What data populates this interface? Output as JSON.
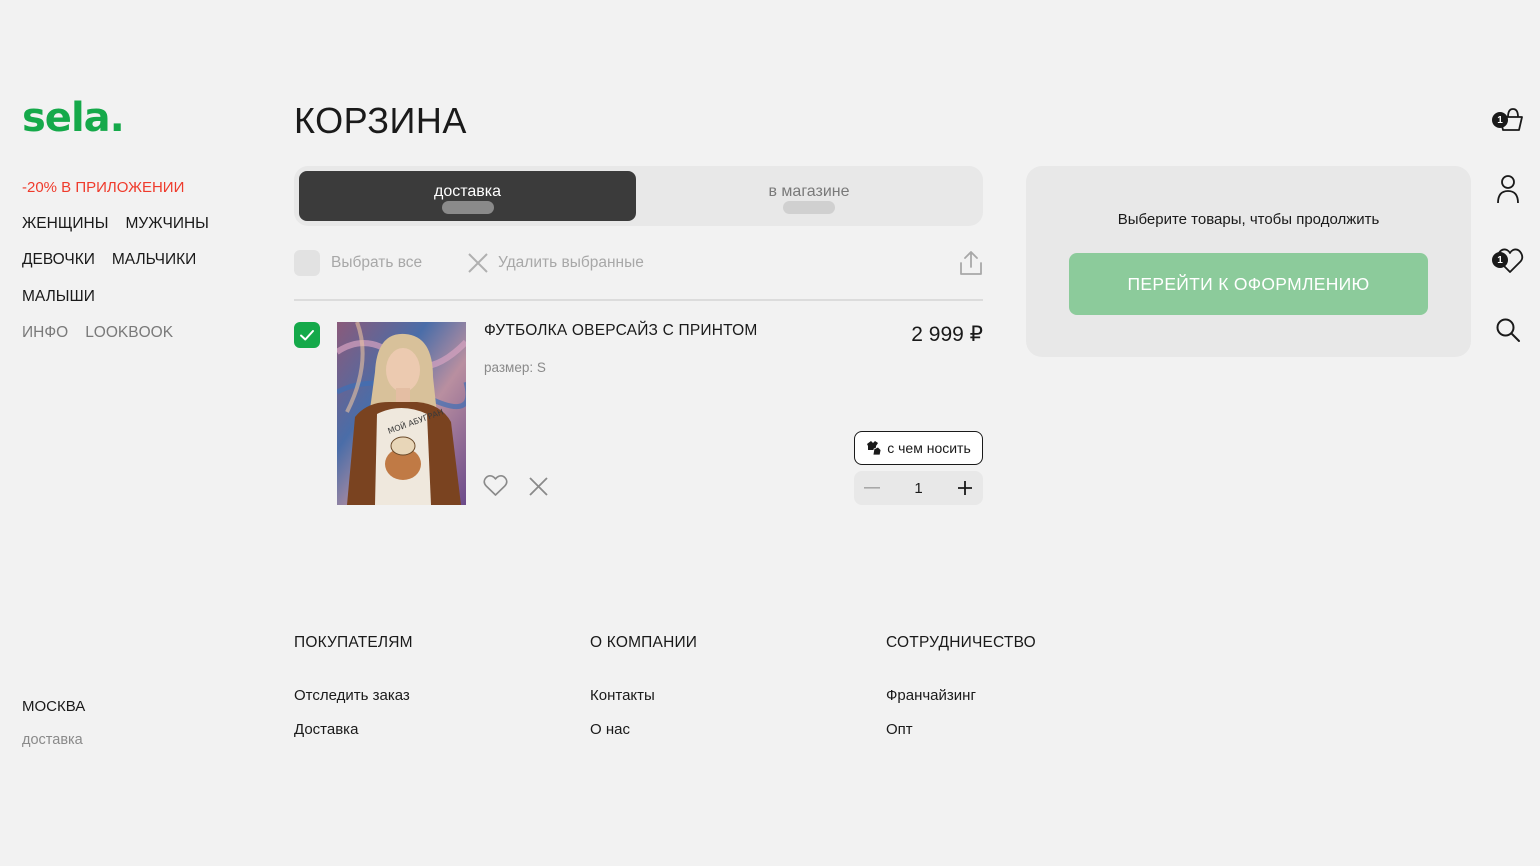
{
  "brand": {
    "logo_text": "sela.",
    "color": "#15a94a"
  },
  "sidebar": {
    "promo": "-20% В ПРИЛОЖЕНИИ",
    "nav_rows": [
      [
        "ЖЕНЩИНЫ",
        "МУЖЧИНЫ"
      ],
      [
        "ДЕВОЧКИ",
        "МАЛЬЧИКИ"
      ],
      [
        "МАЛЫШИ"
      ]
    ],
    "secondary": [
      "ИНФО",
      "LOOKBOOK"
    ],
    "city": "МОСКВА",
    "city_sub": "доставка"
  },
  "page": {
    "title": "КОРЗИНА"
  },
  "tabs": [
    {
      "label": "доставка",
      "active": true
    },
    {
      "label": "в магазине",
      "active": false
    }
  ],
  "toolbar": {
    "select_all": "Выбрать все",
    "delete_selected": "Удалить выбранные",
    "share_icon": "share-icon"
  },
  "cart_items": [
    {
      "name": "ФУТБОЛКА ОВЕРСАЙЗ С ПРИНТОМ",
      "size_label": "размер: S",
      "price": "2 999 ₽",
      "checked": true,
      "outfit_button": "с чем носить",
      "quantity": "1",
      "print_text": "МОЙ\nАБУГРАН"
    }
  ],
  "summary": {
    "hint": "Выберите товары, чтобы продолжить",
    "checkout_button": "ПЕРЕЙТИ К ОФОРМЛЕНИЮ",
    "button_color": "#8ccb9b"
  },
  "rail": {
    "cart_count": "1",
    "favorites_count": "1"
  },
  "footer": {
    "columns": [
      {
        "title": "ПОКУПАТЕЛЯМ",
        "links": [
          "Отследить заказ",
          "Доставка"
        ]
      },
      {
        "title": "О КОМПАНИИ",
        "links": [
          "Контакты",
          "О нас"
        ]
      },
      {
        "title": "СОТРУДНИЧЕСТВО",
        "links": [
          "Франчайзинг",
          "Опт"
        ]
      }
    ]
  },
  "colors": {
    "promo": "#ef3b2c",
    "background": "#f2f2f2",
    "check_green": "#15a94a"
  }
}
